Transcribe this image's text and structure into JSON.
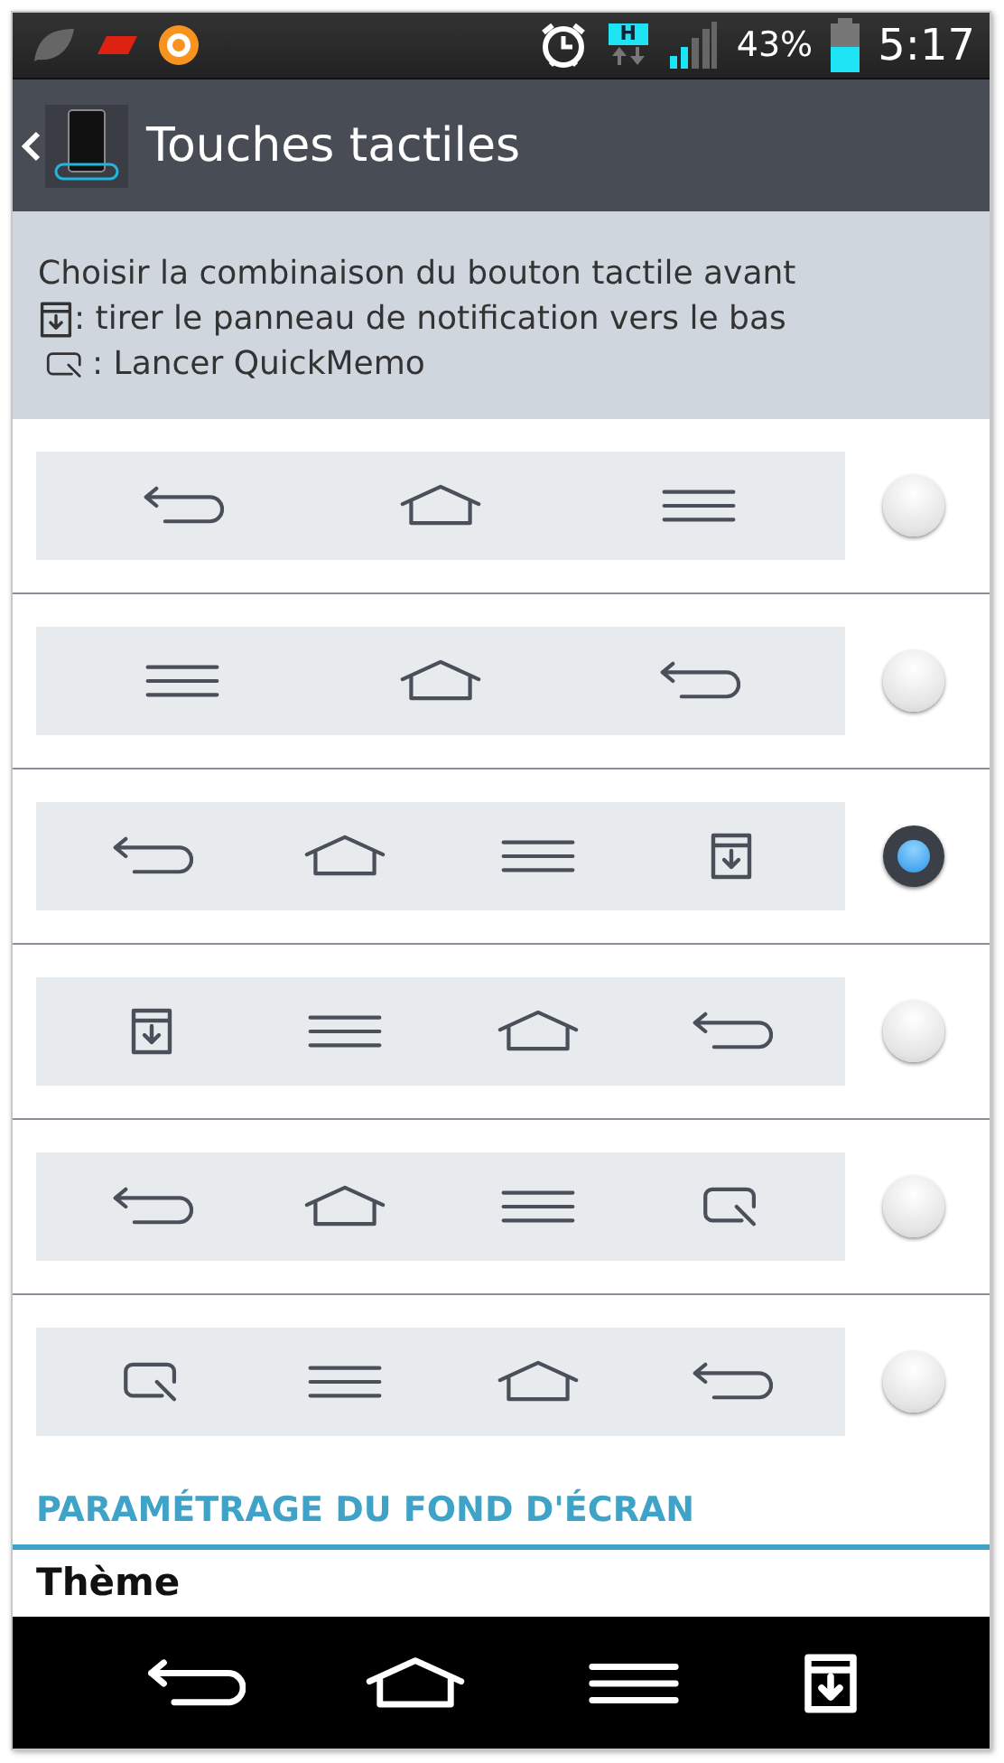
{
  "status_bar": {
    "network_badge": "H",
    "battery": "43%",
    "time": "5:17"
  },
  "header": {
    "title": "Touches tactiles"
  },
  "description": {
    "text": "Choisir la combinaison du bouton tactile avant",
    "legend": [
      {
        "kind": "notification",
        "text": ": tirer le panneau de notification vers le bas"
      },
      {
        "kind": "quickmemo",
        "text": ": Lancer QuickMemo"
      }
    ]
  },
  "options": [
    {
      "keys": [
        {
          "kind": "back"
        },
        {
          "kind": "home"
        },
        {
          "kind": "menu"
        }
      ],
      "selected": false
    },
    {
      "keys": [
        {
          "kind": "menu"
        },
        {
          "kind": "home"
        },
        {
          "kind": "back"
        }
      ],
      "selected": false
    },
    {
      "keys": [
        {
          "kind": "back"
        },
        {
          "kind": "home"
        },
        {
          "kind": "menu"
        },
        {
          "kind": "notification"
        }
      ],
      "selected": true
    },
    {
      "keys": [
        {
          "kind": "notification"
        },
        {
          "kind": "menu"
        },
        {
          "kind": "home"
        },
        {
          "kind": "back"
        }
      ],
      "selected": false
    },
    {
      "keys": [
        {
          "kind": "back"
        },
        {
          "kind": "home"
        },
        {
          "kind": "menu"
        },
        {
          "kind": "quickmemo"
        }
      ],
      "selected": false
    },
    {
      "keys": [
        {
          "kind": "quickmemo"
        },
        {
          "kind": "menu"
        },
        {
          "kind": "home"
        },
        {
          "kind": "back"
        }
      ],
      "selected": false
    }
  ],
  "section": {
    "title": "PARAMÉTRAGE DU FOND D'ÉCRAN",
    "items": [
      {
        "label": "Thème"
      }
    ]
  },
  "nav_bar": {
    "keys": [
      {
        "kind": "back"
      },
      {
        "kind": "home"
      },
      {
        "kind": "menu"
      },
      {
        "kind": "notification"
      }
    ]
  }
}
